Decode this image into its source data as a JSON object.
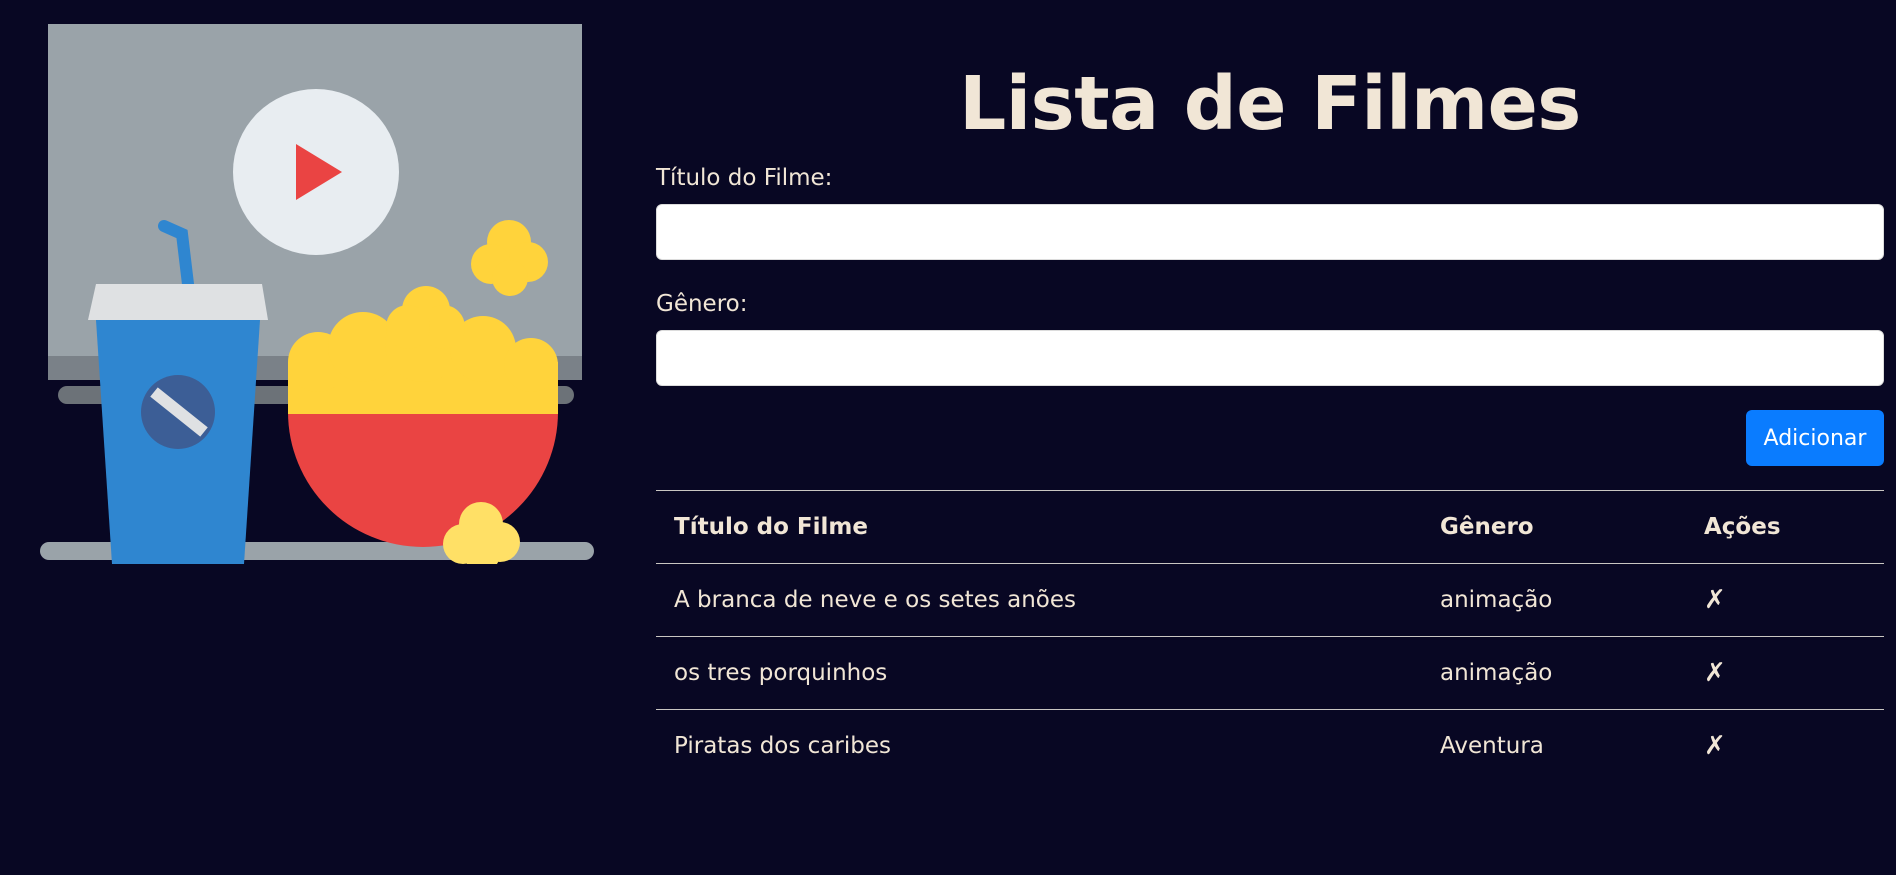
{
  "header": {
    "title": "Lista de Filmes"
  },
  "form": {
    "title_label": "Título do Filme:",
    "title_value": "",
    "genre_label": "Gênero:",
    "genre_value": "",
    "add_button": "Adicionar"
  },
  "table": {
    "headers": [
      "Título do Filme",
      "Gênero",
      "Ações"
    ],
    "rows": [
      {
        "title": "A branca de neve e os setes anões",
        "genre": "animação",
        "action": "✗"
      },
      {
        "title": "os tres porquinhos",
        "genre": "animação",
        "action": "✗"
      },
      {
        "title": "Piratas dos caribes",
        "genre": "Aventura",
        "action": "✗"
      }
    ]
  },
  "illustration": {
    "icons": [
      "tv-screen",
      "play-icon",
      "soda-cup-icon",
      "popcorn-bowl-icon"
    ],
    "colors": {
      "background": "#080723",
      "screen": "#9aa3a9",
      "play_circle": "#e8edf1",
      "play_triangle": "#ea4443",
      "cup": "#2f86d0",
      "bowl": "#ea4443",
      "popcorn": "#ffd33b"
    }
  },
  "colors": {
    "accent": "#0a7cff",
    "text": "#f1e6d6"
  }
}
